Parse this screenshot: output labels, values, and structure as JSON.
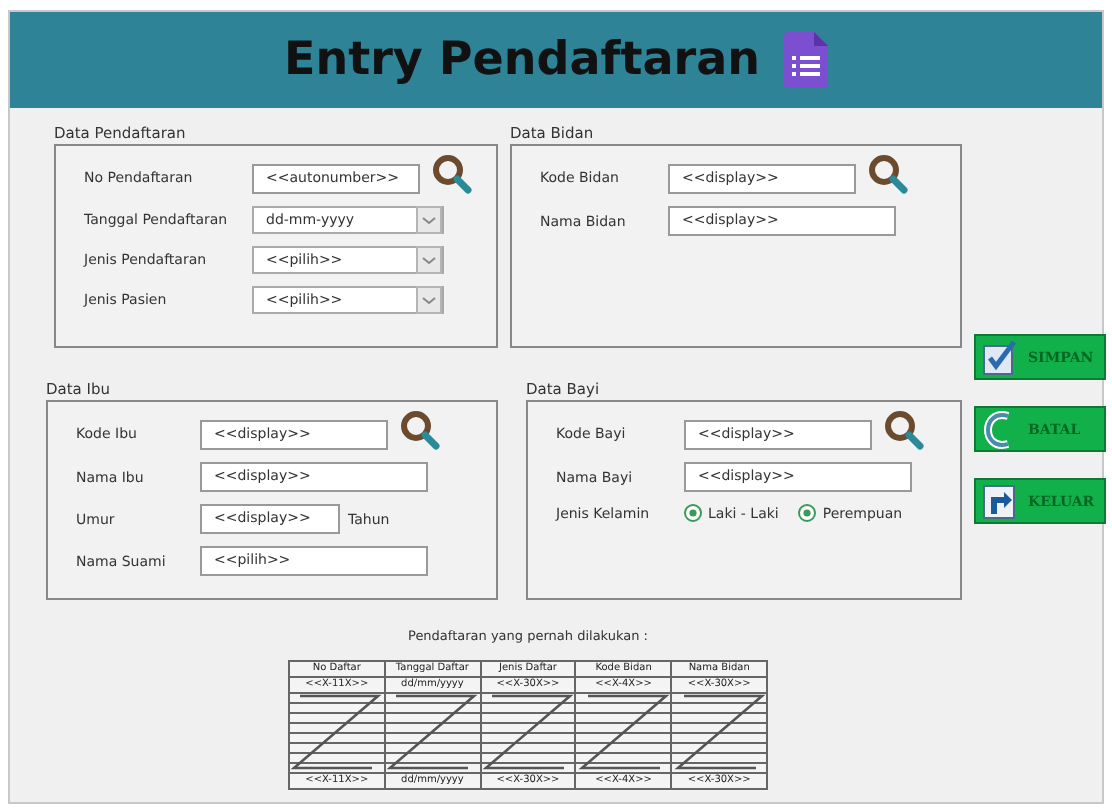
{
  "header": {
    "title": "Entry Pendaftaran"
  },
  "panels": [
    {
      "title": "Data Pendaftaran",
      "fields": [
        {
          "label": "No Pendaftaran",
          "kind": "text",
          "value": "<<autonumber>>",
          "search": true
        },
        {
          "label": "Tanggal Pendaftaran",
          "kind": "dropdown",
          "value": "dd-mm-yyyy"
        },
        {
          "label": "Jenis Pendaftaran",
          "kind": "dropdown",
          "value": "<<pilih>>"
        },
        {
          "label": "Jenis Pasien",
          "kind": "dropdown",
          "value": "<<pilih>>"
        }
      ]
    },
    {
      "title": "Data Bidan",
      "fields": [
        {
          "label": "Kode Bidan",
          "kind": "text",
          "value": "<<display>>",
          "search": true
        },
        {
          "label": "Nama Bidan",
          "kind": "text",
          "value": "<<display>>"
        }
      ]
    },
    {
      "title": "Data Ibu",
      "fields": [
        {
          "label": "Kode Ibu",
          "kind": "text",
          "value": "<<display>>",
          "search": true
        },
        {
          "label": "Nama Ibu",
          "kind": "text",
          "value": "<<display>>"
        },
        {
          "label": "Umur",
          "kind": "text",
          "value": "<<display>>",
          "suffix": "Tahun"
        },
        {
          "label": "Nama Suami",
          "kind": "text",
          "value": "<<pilih>>"
        }
      ]
    },
    {
      "title": "Data Bayi",
      "fields": [
        {
          "label": "Kode Bayi",
          "kind": "text",
          "value": "<<display>>",
          "search": true
        },
        {
          "label": "Nama Bayi",
          "kind": "text",
          "value": "<<display>>"
        },
        {
          "label": "Jenis Kelamin",
          "kind": "radio",
          "options": [
            {
              "label": "Laki - Laki",
              "selected": true
            },
            {
              "label": "Perempuan",
              "selected": true
            }
          ]
        }
      ]
    }
  ],
  "buttons": [
    {
      "label": "SIMPAN",
      "kind": "save"
    },
    {
      "label": "BATAL",
      "kind": "cancel"
    },
    {
      "label": "KELUAR",
      "kind": "exit"
    }
  ],
  "history": {
    "caption": "Pendaftaran yang pernah dilakukan :",
    "columns": [
      "No Daftar",
      "Tanggal Daftar",
      "Jenis Daftar",
      "Kode Bidan",
      "Nama Bidan"
    ],
    "first_row": [
      "<<X-11X>>",
      "dd/mm/yyyy",
      "<<X-30X>>",
      "<<X-4X>>",
      "<<X-30X>>"
    ],
    "last_row": [
      "<<X-11X>>",
      "dd/mm/yyyy",
      "<<X-30X>>",
      "<<X-4X>>",
      "<<X-30X>>"
    ]
  }
}
